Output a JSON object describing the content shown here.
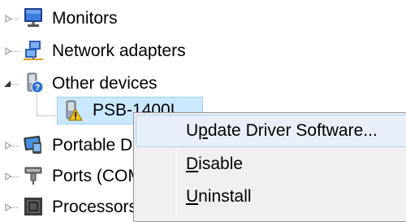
{
  "tree": {
    "items": [
      {
        "label": "Monitors",
        "icon": "monitor-icon"
      },
      {
        "label": "Network adapters",
        "icon": "network-adapter-icon"
      },
      {
        "label": "Other devices",
        "icon": "unknown-device-icon"
      },
      {
        "label": "PSB-1400L",
        "icon": "warning-device-icon"
      },
      {
        "label": "Portable Devices",
        "icon": "portable-device-icon"
      },
      {
        "label": "Ports (COM & LPT)",
        "icon": "port-icon"
      },
      {
        "label": "Processors",
        "icon": "processor-icon"
      }
    ]
  },
  "context_menu": {
    "items": [
      {
        "pre": "U",
        "acc": "p",
        "post": "date Driver Software..."
      },
      {
        "pre": "",
        "acc": "D",
        "post": "isable"
      },
      {
        "pre": "",
        "acc": "U",
        "post": "ninstall"
      }
    ]
  }
}
